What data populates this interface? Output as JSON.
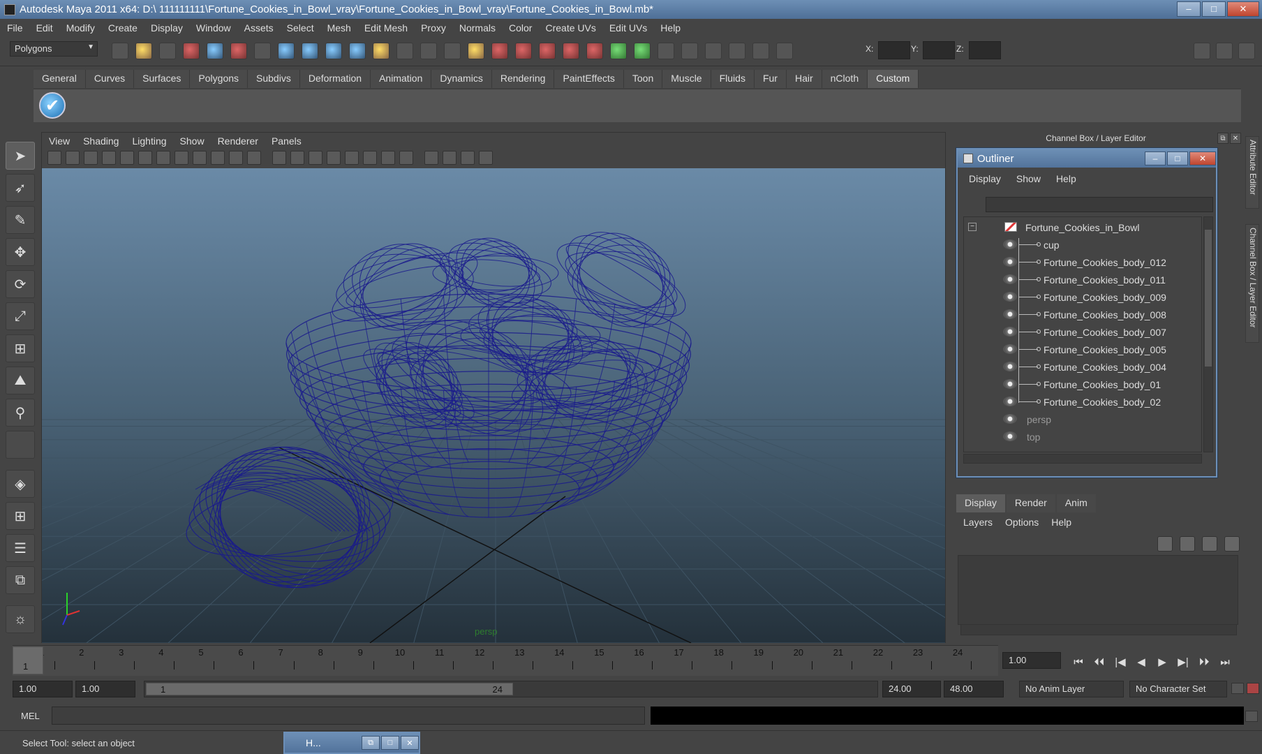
{
  "window": {
    "title": "Autodesk Maya 2011 x64: D:\\ 111111111\\Fortune_Cookies_in_Bowl_vray\\Fortune_Cookies_in_Bowl_vray\\Fortune_Cookies_in_Bowl.mb*",
    "min": "–",
    "max": "□",
    "close": "✕"
  },
  "menubar": [
    "File",
    "Edit",
    "Modify",
    "Create",
    "Display",
    "Window",
    "Assets",
    "Select",
    "Mesh",
    "Edit Mesh",
    "Proxy",
    "Normals",
    "Color",
    "Create UVs",
    "Edit UVs",
    "Help"
  ],
  "statusline": {
    "mode": "Polygons",
    "x_label": "X:",
    "y_label": "Y:",
    "z_label": "Z:"
  },
  "shelf": {
    "tabs": [
      "General",
      "Curves",
      "Surfaces",
      "Polygons",
      "Subdivs",
      "Deformation",
      "Animation",
      "Dynamics",
      "Rendering",
      "PaintEffects",
      "Toon",
      "Muscle",
      "Fluids",
      "Fur",
      "Hair",
      "nCloth",
      "Custom"
    ],
    "active_tab": "Custom",
    "check_glyph": "✔"
  },
  "viewport": {
    "menu": [
      "View",
      "Shading",
      "Lighting",
      "Show",
      "Renderer",
      "Panels"
    ],
    "camera_label": "persp",
    "wire_color": "#1a1a8c"
  },
  "channel_box": {
    "title": "Channel Box / Layer Editor",
    "side_tabs": [
      "Attribute Editor",
      "Channel Box / Layer Editor"
    ]
  },
  "outliner": {
    "title": "Outliner",
    "menu": [
      "Display",
      "Show",
      "Help"
    ],
    "collapse_glyph": "−",
    "root": "Fortune_Cookies_in_Bowl",
    "children": [
      "cup",
      "Fortune_Cookies_body_012",
      "Fortune_Cookies_body_011",
      "Fortune_Cookies_body_009",
      "Fortune_Cookies_body_008",
      "Fortune_Cookies_body_007",
      "Fortune_Cookies_body_005",
      "Fortune_Cookies_body_004",
      "Fortune_Cookies_body_01",
      "Fortune_Cookies_body_02"
    ],
    "cameras": [
      "persp",
      "top"
    ]
  },
  "layer_editor": {
    "tabs": [
      "Display",
      "Render",
      "Anim"
    ],
    "active_tab": "Display",
    "menu": [
      "Layers",
      "Options",
      "Help"
    ]
  },
  "timeline": {
    "ticks": [
      "1",
      "2",
      "3",
      "4",
      "5",
      "6",
      "7",
      "8",
      "9",
      "10",
      "11",
      "12",
      "13",
      "14",
      "15",
      "16",
      "17",
      "18",
      "19",
      "20",
      "21",
      "22",
      "23",
      "24"
    ],
    "current_frame": "1",
    "current_time_field": "1.00",
    "play_buttons": [
      "⏮",
      "⏴⏴",
      "|◀",
      "◀",
      "▶",
      "▶|",
      "⏵⏵",
      "⏭"
    ]
  },
  "range": {
    "start_time": "1.00",
    "playback_start": "1.00",
    "handle_start": "1",
    "handle_end": "24",
    "playback_end": "24.00",
    "end_time": "48.00",
    "anim_layer": "No Anim Layer",
    "character_set": "No Character Set"
  },
  "cmdline": {
    "label": "MEL"
  },
  "helpline": {
    "message": "Select Tool: select an object"
  },
  "minimized_window": {
    "title": "H..."
  }
}
